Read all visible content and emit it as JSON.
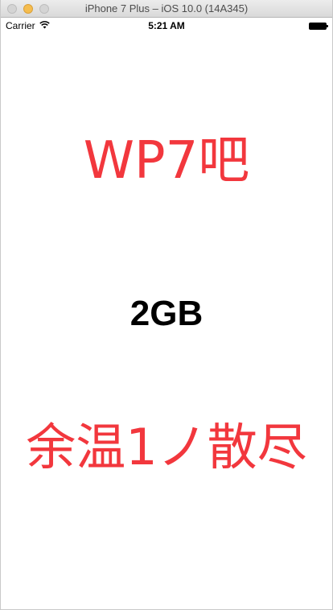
{
  "window": {
    "title": "iPhone 7 Plus – iOS 10.0 (14A345)"
  },
  "status_bar": {
    "carrier": "Carrier",
    "time": "5:21 AM",
    "icons": [
      "wifi-icon",
      "battery-icon"
    ]
  },
  "content": {
    "headline_top": "WP7吧",
    "memory_label": "2GB",
    "headline_bottom": "余温1ノ散尽"
  },
  "colors": {
    "accent_red": "#f2373d",
    "text_black": "#000000",
    "background": "#ffffff"
  }
}
